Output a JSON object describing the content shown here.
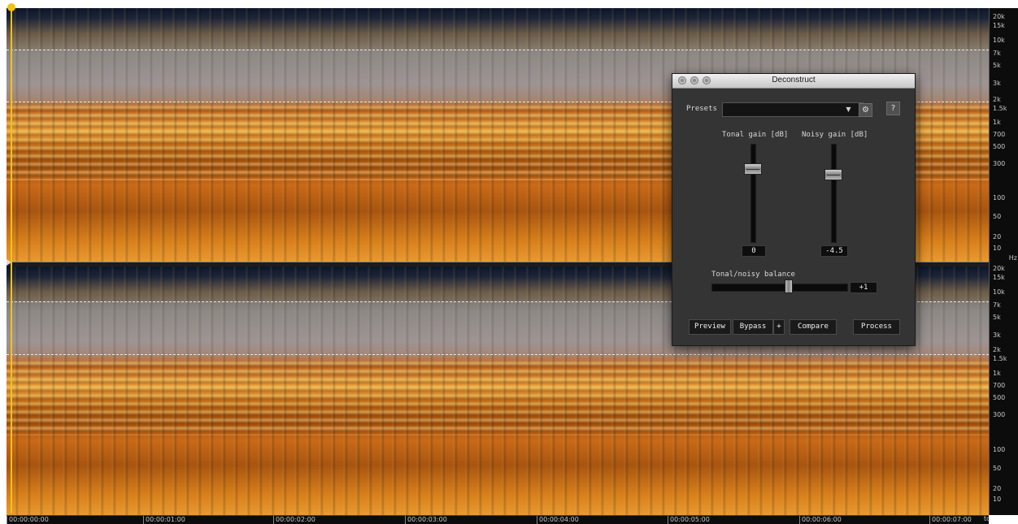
{
  "hz_axis": {
    "unit": "Hz",
    "labels": [
      "20k",
      "15k",
      "10k",
      "7k",
      "5k",
      "3k",
      "2k",
      "1.5k",
      "1k",
      "700",
      "500",
      "300",
      "100",
      "50",
      "20",
      "10"
    ]
  },
  "time_axis": {
    "unit": "tc",
    "labels": [
      "00:00:00:00",
      "00:00:01:00",
      "00:00:02:00",
      "00:00:03:00",
      "00:00:04:00",
      "00:00:05:00",
      "00:00:06:00",
      "00:00:07:00"
    ]
  },
  "dialog": {
    "title": "Deconstruct",
    "presets_label": "Presets",
    "presets_value": "",
    "presets_dropdown_glyph": "▼",
    "settings_glyph": "⚙",
    "help_label": "?",
    "tonal_gain": {
      "label": "Tonal gain [dB]",
      "value": "0"
    },
    "noisy_gain": {
      "label": "Noisy gain [dB]",
      "value": "-4.5"
    },
    "balance": {
      "label": "Tonal/noisy balance",
      "value": "+1"
    },
    "buttons": {
      "preview": "Preview",
      "bypass": "Bypass",
      "plus": "+",
      "compare": "Compare",
      "process": "Process"
    }
  }
}
